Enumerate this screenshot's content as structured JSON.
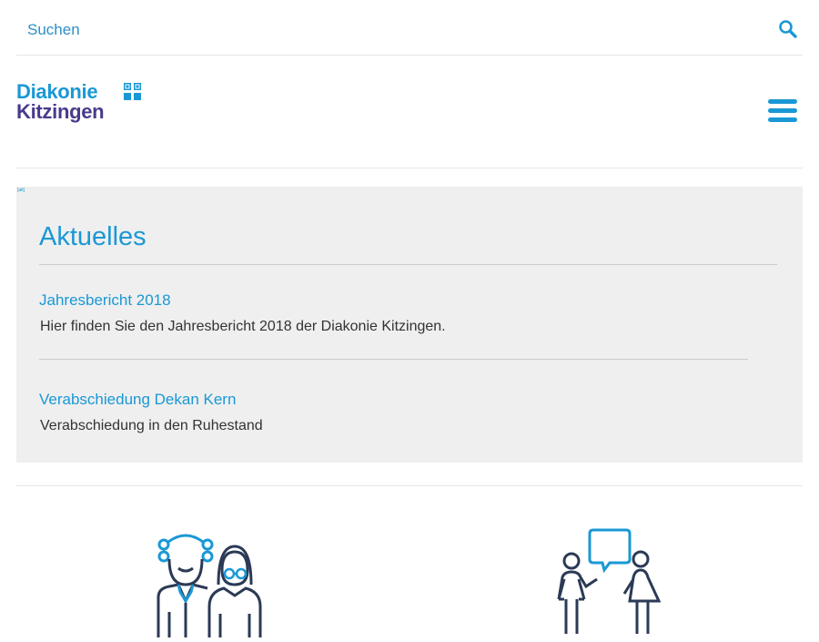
{
  "search": {
    "placeholder": "Suchen",
    "value": ""
  },
  "header": {
    "logo_line1": "Diakonie",
    "logo_line2": "Kitzingen"
  },
  "news": {
    "broken_image_alt": "[alt]",
    "title": "Aktuelles",
    "items": [
      {
        "title": "Jahresbericht 2018",
        "text": "Hier finden Sie den Jahresbericht 2018 der Diakonie Kitzingen."
      },
      {
        "title": "Verabschiedung Dekan Kern",
        "text": "Verabschiedung in den Ruhestand"
      }
    ]
  },
  "icons": {
    "search": "search-icon",
    "menu": "hamburger-menu-icon",
    "elderly": "elderly-couple-icon",
    "counseling": "counseling-icon"
  },
  "colors": {
    "brand_blue": "#1a98d5",
    "brand_purple": "#4a3a8c",
    "icon_dark": "#2b3a55",
    "link_blue": "#2c8fc7",
    "panel_gray": "#efefef"
  }
}
